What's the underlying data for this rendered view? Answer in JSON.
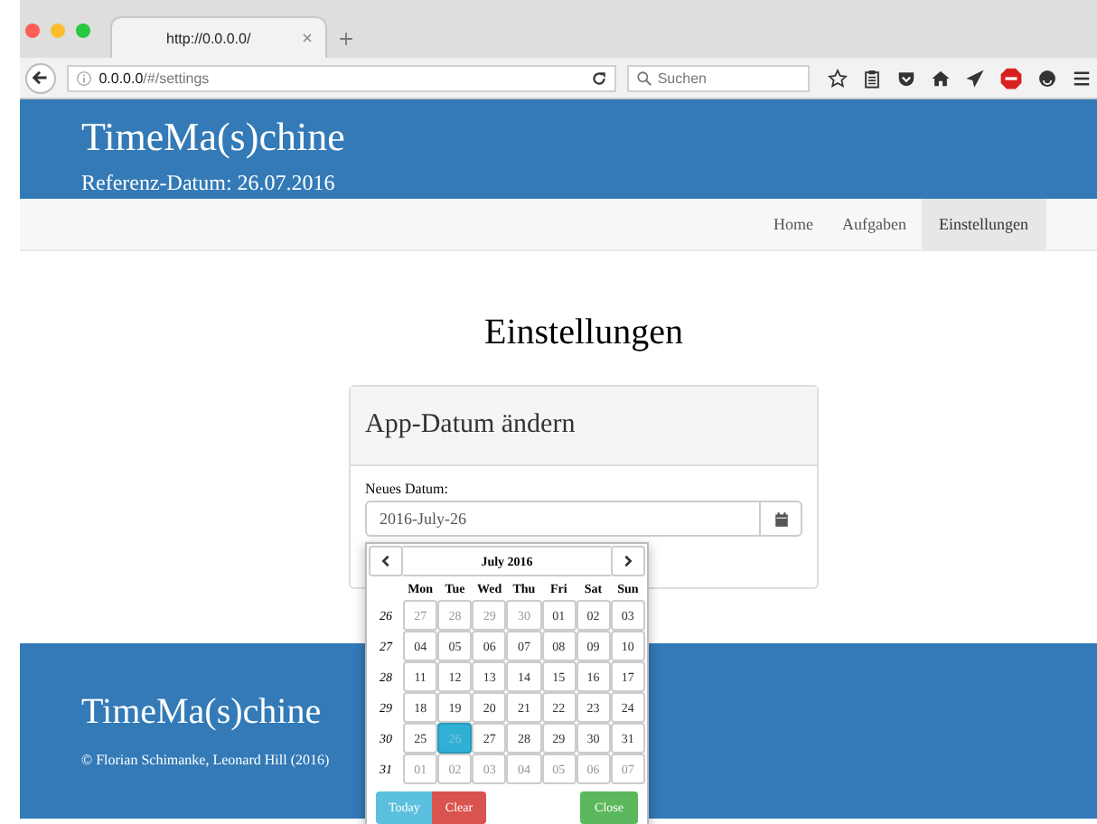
{
  "browser": {
    "tab_title": "http://0.0.0.0/",
    "url_host": "0.0.0.0",
    "url_path": "/#/settings",
    "search_placeholder": "Suchen"
  },
  "header": {
    "brand": "TimeMa(s)chine",
    "reference": "Referenz-Datum: 26.07.2016"
  },
  "nav": [
    {
      "label": "Home",
      "selected": false
    },
    {
      "label": "Aufgaben",
      "selected": false
    },
    {
      "label": "Einstellungen",
      "selected": true
    }
  ],
  "page_title": "Einstellungen",
  "panel": {
    "title": "App-Datum ändern",
    "label": "Neues Datum:",
    "value": "2016-July-26"
  },
  "datepicker": {
    "month": "July 2016",
    "weekdays": [
      "Mon",
      "Tue",
      "Wed",
      "Thu",
      "Fri",
      "Sat",
      "Sun"
    ],
    "weeks": [
      {
        "number": "26",
        "days": [
          {
            "label": "27",
            "muted": true,
            "selected": false
          },
          {
            "label": "28",
            "muted": true,
            "selected": false
          },
          {
            "label": "29",
            "muted": true,
            "selected": false
          },
          {
            "label": "30",
            "muted": true,
            "selected": false
          },
          {
            "label": "01",
            "muted": false,
            "selected": false
          },
          {
            "label": "02",
            "muted": false,
            "selected": false
          },
          {
            "label": "03",
            "muted": false,
            "selected": false
          }
        ]
      },
      {
        "number": "27",
        "days": [
          {
            "label": "04",
            "muted": false,
            "selected": false
          },
          {
            "label": "05",
            "muted": false,
            "selected": false
          },
          {
            "label": "06",
            "muted": false,
            "selected": false
          },
          {
            "label": "07",
            "muted": false,
            "selected": false
          },
          {
            "label": "08",
            "muted": false,
            "selected": false
          },
          {
            "label": "09",
            "muted": false,
            "selected": false
          },
          {
            "label": "10",
            "muted": false,
            "selected": false
          }
        ]
      },
      {
        "number": "28",
        "days": [
          {
            "label": "11",
            "muted": false,
            "selected": false
          },
          {
            "label": "12",
            "muted": false,
            "selected": false
          },
          {
            "label": "13",
            "muted": false,
            "selected": false
          },
          {
            "label": "14",
            "muted": false,
            "selected": false
          },
          {
            "label": "15",
            "muted": false,
            "selected": false
          },
          {
            "label": "16",
            "muted": false,
            "selected": false
          },
          {
            "label": "17",
            "muted": false,
            "selected": false
          }
        ]
      },
      {
        "number": "29",
        "days": [
          {
            "label": "18",
            "muted": false,
            "selected": false
          },
          {
            "label": "19",
            "muted": false,
            "selected": false
          },
          {
            "label": "20",
            "muted": false,
            "selected": false
          },
          {
            "label": "21",
            "muted": false,
            "selected": false
          },
          {
            "label": "22",
            "muted": false,
            "selected": false
          },
          {
            "label": "23",
            "muted": false,
            "selected": false
          },
          {
            "label": "24",
            "muted": false,
            "selected": false
          }
        ]
      },
      {
        "number": "30",
        "days": [
          {
            "label": "25",
            "muted": false,
            "selected": false
          },
          {
            "label": "26",
            "muted": false,
            "selected": true
          },
          {
            "label": "27",
            "muted": false,
            "selected": false
          },
          {
            "label": "28",
            "muted": false,
            "selected": false
          },
          {
            "label": "29",
            "muted": false,
            "selected": false
          },
          {
            "label": "30",
            "muted": false,
            "selected": false
          },
          {
            "label": "31",
            "muted": false,
            "selected": false
          }
        ]
      },
      {
        "number": "31",
        "days": [
          {
            "label": "01",
            "muted": true,
            "selected": false
          },
          {
            "label": "02",
            "muted": true,
            "selected": false
          },
          {
            "label": "03",
            "muted": true,
            "selected": false
          },
          {
            "label": "04",
            "muted": true,
            "selected": false
          },
          {
            "label": "05",
            "muted": true,
            "selected": false
          },
          {
            "label": "06",
            "muted": true,
            "selected": false
          },
          {
            "label": "07",
            "muted": true,
            "selected": false
          }
        ]
      }
    ],
    "buttons": [
      {
        "label": "Today",
        "kind": "info"
      },
      {
        "label": "Clear",
        "kind": "danger"
      },
      {
        "label": "Close",
        "kind": "success"
      }
    ]
  },
  "footer": {
    "brand": "TimeMa(s)chine",
    "copyright": "© Florian Schimanke, Leonard Hill (2016)"
  }
}
